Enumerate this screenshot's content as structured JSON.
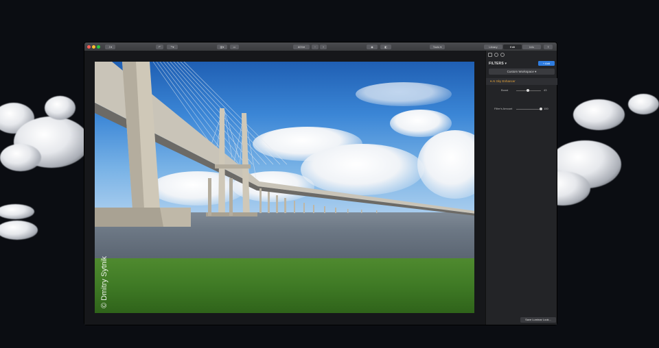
{
  "window": {
    "traffic_lights": [
      "#ff5f57",
      "#febc2e",
      "#28c840"
    ]
  },
  "toolbar": {
    "zoom_value": "80%",
    "zoom_minus": "−",
    "zoom_plus": "+",
    "tools_label": "Tools",
    "tabs": [
      {
        "label": "Library",
        "active": false
      },
      {
        "label": "Edit",
        "active": true
      },
      {
        "label": "Info",
        "active": false
      }
    ],
    "icons": [
      "import-icon",
      "undo-icon",
      "layout-icon",
      "compare-icon",
      "eye-icon",
      "split-view-icon",
      "share-icon"
    ]
  },
  "photo": {
    "watermark": "© Dmitry Sytnik"
  },
  "panel": {
    "icons": [
      "histogram-icon",
      "layers-icon",
      "history-icon"
    ],
    "filters_label": "FILTERS",
    "add_label": "+ Add",
    "workspace_label": "Custom Workspace",
    "filter_name": "AI Sky Enhancer",
    "sliders": [
      {
        "label": "Boost",
        "value": "43",
        "fraction": 0.43
      },
      {
        "label": "Filter's Amount",
        "value": "100",
        "fraction": 1.0
      }
    ],
    "save_look_label": "Save Luminar Look..."
  },
  "colors": {
    "accent": "#2f7de1",
    "filter_title": "#e3a33a",
    "background": "#0b0d12"
  }
}
